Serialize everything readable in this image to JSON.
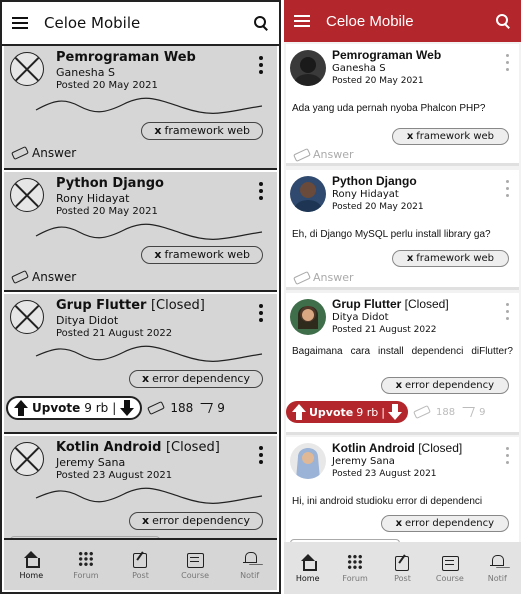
{
  "app": {
    "title": "Celoe Mobile"
  },
  "posts": [
    {
      "title": "Pemrograman Web",
      "closed_label": "",
      "author": "Ganesha S",
      "date": "Posted 20 May 2021",
      "body": "Ada yang uda pernah nyoba Phalcon PHP?",
      "tag_x": "x",
      "tag": "framework web",
      "answer": "Answer"
    },
    {
      "title": "Python Django",
      "closed_label": "",
      "author": "Rony Hidayat",
      "date": "Posted 20 May 2021",
      "body": "Eh, di Django MySQL perlu install library ga?",
      "tag_x": "x",
      "tag": "framework web",
      "answer": "Answer"
    },
    {
      "title": "Grup Flutter",
      "closed_label": "[Closed]",
      "author": "Ditya Didot",
      "date": "Posted 21 August 2022",
      "date_mock": "Posted 21 August 2022",
      "body": "Bagaimana cara install dependenci diFlutter?",
      "tag_x": "x",
      "tag": "error dependency",
      "upvote_label": "Upvote",
      "upvote_count": "9 rb",
      "separator": "|",
      "answers_count": "188",
      "shares_count": "9"
    },
    {
      "title": "Kotlin Android",
      "closed_label": "[Closed]",
      "author": "Jeremy Sana",
      "date": "Posted 23 August 2021",
      "body": "Hi, ini android studioku error di dependenci",
      "tag_x": "x",
      "tag": "error dependency"
    }
  ],
  "nav": [
    {
      "label": "Home",
      "icon": "home-icon",
      "active": true
    },
    {
      "label": "Forum",
      "icon": "forum-icon"
    },
    {
      "label": "Post",
      "icon": "post-icon"
    },
    {
      "label": "Course",
      "icon": "course-icon"
    },
    {
      "label": "Notif",
      "icon": "notif-icon"
    }
  ],
  "colors": {
    "accent": "#b3262c",
    "wire_card": "#d6d6d6",
    "mock_bg": "#f2f2f2"
  }
}
